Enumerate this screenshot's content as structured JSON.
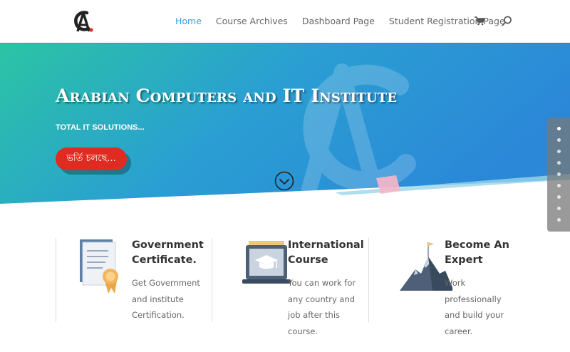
{
  "header": {
    "logo_name": "ACIT logo",
    "nav": [
      {
        "label": "Home",
        "active": true
      },
      {
        "label": "Course Archives",
        "active": false
      },
      {
        "label": "Dashboard Page",
        "active": false
      },
      {
        "label": "Student Registration Page",
        "active": false
      }
    ],
    "cart_icon": "cart-icon",
    "search_icon": "search-icon"
  },
  "hero": {
    "title": "Arabian Computers and IT Institute",
    "subtitle": "TOTAL IT SOLUTIONS...",
    "cta_label": "ভর্তি চলছে...",
    "scroll_icon": "chevron-down-circle-icon"
  },
  "dot_nav": {
    "count": 9,
    "active_index": 0
  },
  "features": [
    {
      "title": "Government Certificate.",
      "text": "Get Government and institute Certification.",
      "icon": "certificate-icon"
    },
    {
      "title": "International Course",
      "text": "You can work for any country and job after this course.",
      "icon": "laptop-graduation-icon"
    },
    {
      "title": "Become An Expert",
      "text": "Work professionally and build your career.",
      "icon": "mountain-flag-icon"
    }
  ],
  "colors": {
    "accent_blue": "#2ea3f2",
    "hero_start": "#2bc4a4",
    "hero_end": "#2b88d8",
    "cta_red": "#e02b20"
  }
}
